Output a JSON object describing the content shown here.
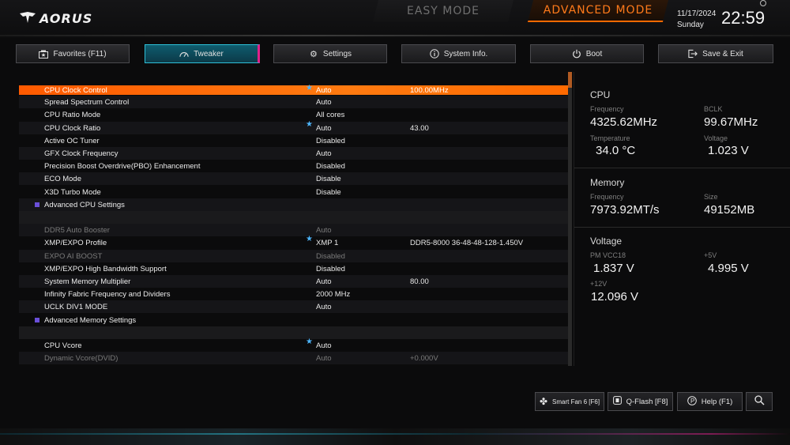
{
  "header": {
    "logo_text": "AORUS",
    "easy_mode_label": "EASY MODE",
    "advanced_mode_label": "ADVANCED MODE",
    "date": "11/17/2024",
    "day": "Sunday",
    "time": "22:59"
  },
  "tabs": [
    {
      "label": "Favorites (F11)",
      "icon": "favorites-icon"
    },
    {
      "label": "Tweaker",
      "icon": "speedometer-icon",
      "active": true
    },
    {
      "label": "Settings",
      "icon": "gear-icon"
    },
    {
      "label": "System Info.",
      "icon": "info-icon"
    },
    {
      "label": "Boot",
      "icon": "power-icon"
    },
    {
      "label": "Save & Exit",
      "icon": "exit-icon"
    }
  ],
  "settings": [
    {
      "name": "CPU Clock Control",
      "star": true,
      "value": "Auto",
      "value2": "100.00MHz",
      "selected": true
    },
    {
      "name": "Spread Spectrum Control",
      "value": "Auto"
    },
    {
      "name": "CPU Ratio Mode",
      "value": "All cores"
    },
    {
      "name": "CPU Clock Ratio",
      "star": true,
      "value": "Auto",
      "value2": "43.00"
    },
    {
      "name": "Active OC Tuner",
      "value": "Disabled"
    },
    {
      "name": "GFX Clock Frequency",
      "value": "Auto"
    },
    {
      "name": "Precision Boost Overdrive(PBO) Enhancement",
      "value": "Disabled"
    },
    {
      "name": "ECO Mode",
      "value": "Disable"
    },
    {
      "name": "X3D Turbo Mode",
      "value": "Disable"
    },
    {
      "name": "Advanced CPU Settings",
      "submenu": true
    },
    {
      "name": "",
      "separator": true
    },
    {
      "name": "DDR5 Auto Booster",
      "value": "Auto",
      "dim": true
    },
    {
      "name": "XMP/EXPO Profile",
      "star": true,
      "value": "XMP 1",
      "value2": "DDR5-8000 36-48-48-128-1.450V"
    },
    {
      "name": "EXPO AI BOOST",
      "value": "Disabled",
      "dim": true
    },
    {
      "name": "XMP/EXPO High Bandwidth Support",
      "value": "Disabled"
    },
    {
      "name": "System Memory Multiplier",
      "value": "Auto",
      "value2": "80.00"
    },
    {
      "name": "Infinity Fabric Frequency and Dividers",
      "value": "2000 MHz"
    },
    {
      "name": "UCLK DIV1 MODE",
      "value": "Auto"
    },
    {
      "name": "Advanced Memory Settings",
      "submenu": true
    },
    {
      "name": "",
      "separator": true
    },
    {
      "name": "CPU Vcore",
      "star": true,
      "value": "Auto"
    },
    {
      "name": "Dynamic Vcore(DVID)",
      "value": "Auto",
      "value2": "+0.000V",
      "dim": true
    }
  ],
  "monitor": {
    "cpu": {
      "title": "CPU",
      "frequency_label": "Frequency",
      "frequency": "4325.62MHz",
      "bclk_label": "BCLK",
      "bclk": "99.67MHz",
      "temperature_label": "Temperature",
      "temperature": "34.0 °C",
      "voltage_label": "Voltage",
      "voltage": "1.023 V"
    },
    "memory": {
      "title": "Memory",
      "frequency_label": "Frequency",
      "frequency": "7973.92MT/s",
      "size_label": "Size",
      "size": "49152MB"
    },
    "voltage": {
      "title": "Voltage",
      "pm_vcc18_label": "PM VCC18",
      "pm_vcc18": "1.837 V",
      "p5v_label": "+5V",
      "p5v": "4.995 V",
      "p12v_label": "+12V",
      "p12v": "12.096 V"
    }
  },
  "bottom_buttons": {
    "smart_fan": "Smart Fan 6 [F6]",
    "qflash": "Q-Flash [F8]",
    "help": "Help (F1)"
  },
  "colors": {
    "accent": "#ff6a00",
    "tab_active": "#0e5c6e",
    "star": "#4db6ff",
    "submenu_marker": "#6a4fd8"
  }
}
